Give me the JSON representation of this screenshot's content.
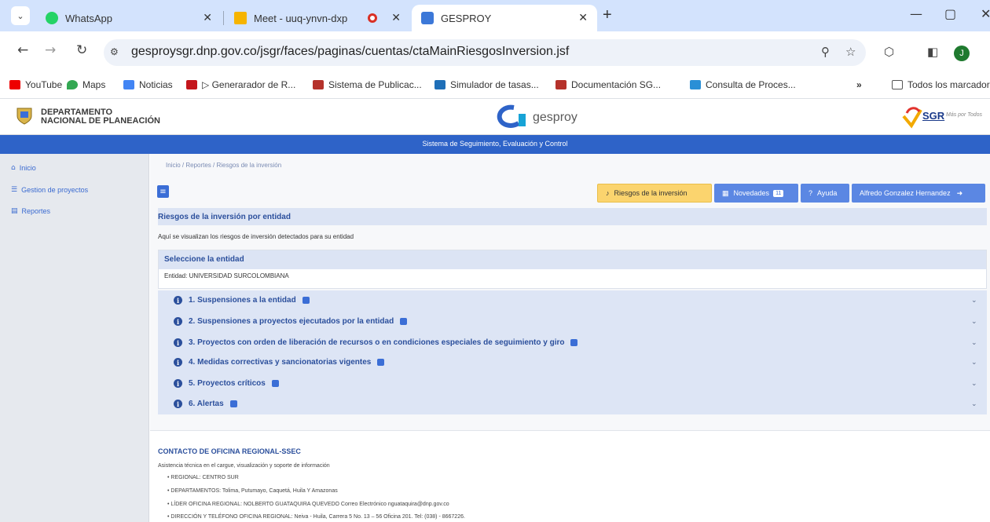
{
  "browser": {
    "tabs": [
      {
        "title": "WhatsApp"
      },
      {
        "title": "Meet - uuq-ynvn-dxp"
      },
      {
        "title": "GESPROY"
      }
    ],
    "url": "gesproysgr.dnp.gov.co/jsgr/faces/paginas/cuentas/ctaMainRiesgosInversion.jsf",
    "profile_initial": "J",
    "bookmarks": [
      "YouTube",
      "Maps",
      "Noticias",
      "▷ Generarador de R...",
      "Sistema de Publicac...",
      "Simulador de tasas...",
      "Documentación SG...",
      "Consulta de Proces...",
      "Todos los marcadore"
    ],
    "more_bookmarks": "»",
    "colors": {
      "tabstrip": "#d3e3fd",
      "accent": "#2e63c8"
    }
  },
  "header": {
    "dnp_line1": "DEPARTAMENTO",
    "dnp_line2": "NACIONAL DE PLANEACIÓN",
    "gesproy_word": "gesproy",
    "sgr_text": "SGR",
    "sgr_sub": "Más por Todos"
  },
  "bluebar": {
    "title": "Sistema de Seguimiento, Evaluación y Control"
  },
  "sidebar": {
    "items": [
      {
        "label": "Inicio",
        "icon": "home-icon"
      },
      {
        "label": "Gestion de proyectos",
        "icon": "list-icon"
      },
      {
        "label": "Reportes",
        "icon": "report-icon"
      }
    ]
  },
  "main": {
    "breadcrumb": "Inicio  /  Reportes / Riesgos de la inversión",
    "buttons": {
      "riesgos": "Riesgos de la inversión",
      "novedades": "Novedades",
      "novedades_count": "11",
      "ayuda": "Ayuda",
      "user": "Alfredo Gonzalez Hernandez"
    },
    "section_title": "Riesgos de la inversión por entidad",
    "intro": "Aquí se visualizan los riesgos de inversión detectados para su entidad",
    "select_label": "Seleccione la entidad",
    "entity": "Entidad: UNIVERSIDAD SURCOLOMBIANA",
    "accordion": [
      "1. Suspensiones a la entidad",
      "2. Suspensiones a proyectos ejecutados por la entidad",
      "3. Proyectos con orden de liberación de recursos o en condiciones especiales de seguimiento y giro",
      "4. Medidas correctivas y sancionatorias vigentes",
      "5. Proyectos críticos",
      "6. Alertas"
    ]
  },
  "contact": {
    "title": "CONTACTO DE OFICINA REGIONAL-SSEC",
    "subtitle": "Asistencia técnica en el cargue, visualización y soporte de información",
    "items": [
      "REGIONAL: CENTRO SUR",
      "DEPARTAMENTOS: Tolima, Putumayo, Caquetá, Huila Y Amazonas",
      "LÍDER OFICINA REGIONAL: NOLBERTO GUATAQUIRA QUEVEDO Correo Electrónico nguataquira@dnp.gov.co",
      "DIRECCIÓN Y TELÉFONO OFICINA REGIONAL: Neiva - Huila, Carrera 5 No. 13 – 56 Oficina 201. Tel: (038) - 8667226."
    ]
  }
}
